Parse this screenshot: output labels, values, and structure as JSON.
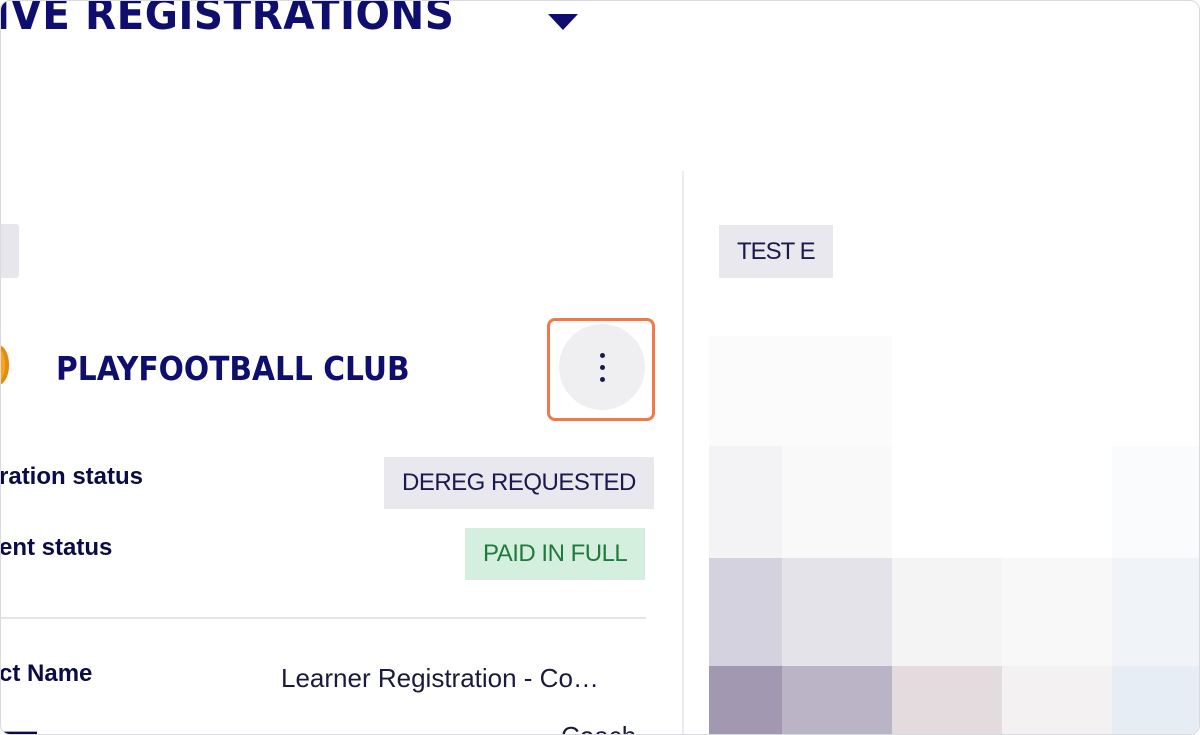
{
  "header": {
    "title": "IVE REGISTRATIONS"
  },
  "card": {
    "club_name": "PLAYFOOTBALL CLUB",
    "rows": [
      {
        "label": "ration status",
        "badge": "DEREG REQUESTED",
        "badge_color": "#e8e8ee"
      },
      {
        "label": "ent status",
        "badge": "PAID IN FULL",
        "badge_color": "#d5efdf"
      }
    ],
    "details": [
      {
        "label": "ct Name",
        "value": "Learner Registration - Co…"
      },
      {
        "label": "",
        "value": "Coach"
      }
    ]
  },
  "right_panel": {
    "chip": "TEST E"
  },
  "colors": {
    "title": "#0e0e6e",
    "highlight": "#f0784a",
    "paid_text": "#1f7a3d"
  },
  "icons": {
    "title_dropdown": "caret-down-icon",
    "more": "more-vertical-icon",
    "logo": "club-logo-icon"
  }
}
